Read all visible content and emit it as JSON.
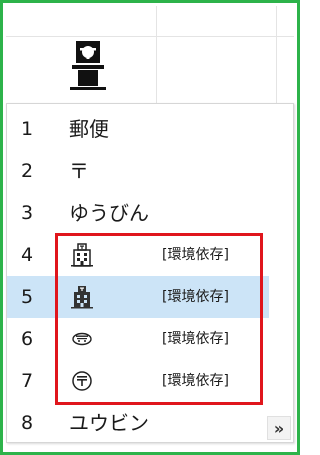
{
  "composition": {
    "icon": "postal-mark-character-icon"
  },
  "candidates": [
    {
      "number": "1",
      "text": "郵便"
    },
    {
      "number": "2",
      "text": "〒"
    },
    {
      "number": "3",
      "text": "ゆうびん"
    },
    {
      "number": "4",
      "icon": "post-office-building-icon",
      "note": "[環境依存]"
    },
    {
      "number": "5",
      "icon": "post-office-building-dark-icon",
      "note": "[環境依存]",
      "selected": true
    },
    {
      "number": "6",
      "icon": "postal-mark-face-icon",
      "note": "[環境依存]"
    },
    {
      "number": "7",
      "icon": "circled-postal-mark-icon",
      "note": "[環境依存]"
    },
    {
      "number": "8",
      "text": "ユウビン"
    }
  ],
  "expand_button": {
    "label": "»"
  },
  "colors": {
    "frame": "#2db34a",
    "selection": "#cce4f7",
    "highlight": "#e0161c"
  }
}
